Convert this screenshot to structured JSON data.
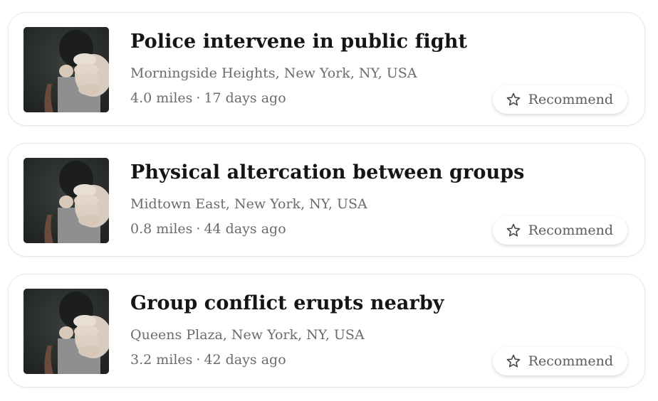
{
  "icons": {
    "thumbnail": "raised-fist-photo",
    "recommend": "star-outline-icon"
  },
  "colors": {
    "title": "#151515",
    "secondary_text": "#6b6b6b",
    "card_border": "#e9e9e9"
  },
  "incidents": [
    {
      "title": "Police intervene in public fight",
      "location": "Morningside Heights, New York, NY, USA",
      "distance": "4.0 miles",
      "separator": "·",
      "age": "17 days ago",
      "recommend_label": "Recommend"
    },
    {
      "title": "Physical altercation between groups",
      "location": "Midtown East, New York, NY, USA",
      "distance": "0.8 miles",
      "separator": "·",
      "age": "44 days ago",
      "recommend_label": "Recommend"
    },
    {
      "title": "Group conflict erupts nearby",
      "location": "Queens Plaza, New York, NY, USA",
      "distance": "3.2 miles",
      "separator": "·",
      "age": "42 days ago",
      "recommend_label": "Recommend"
    }
  ]
}
